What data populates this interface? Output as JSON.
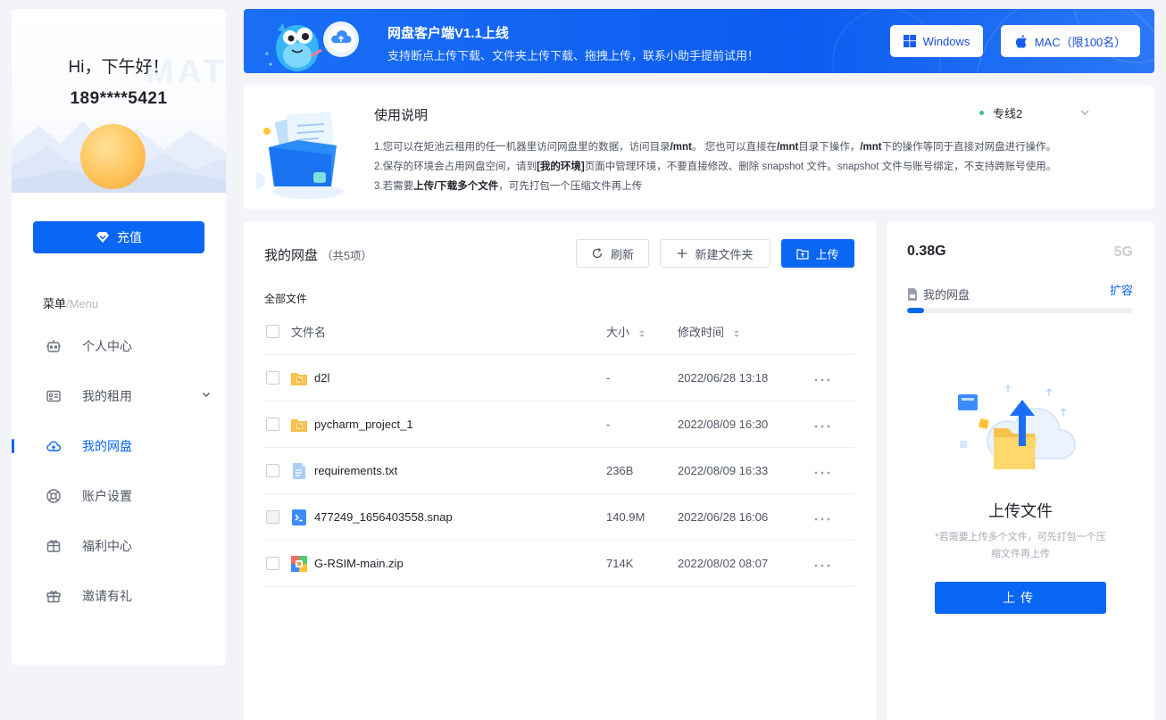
{
  "sidebar": {
    "hero_watermark": "MATPOOL",
    "greeting": "Hi，下午好！",
    "phone": "189****5421",
    "recharge_label": "充值",
    "menu_title": "菜单",
    "menu_title_en": "/Menu",
    "items": [
      {
        "label": "个人中心",
        "icon": "robot-icon"
      },
      {
        "label": "我的租用",
        "icon": "id-card-icon"
      },
      {
        "label": "我的网盘",
        "icon": "cloud-icon",
        "active": true
      },
      {
        "label": "账户设置",
        "icon": "lifebuoy-icon"
      },
      {
        "label": "福利中心",
        "icon": "gift-box-icon"
      },
      {
        "label": "邀请有礼",
        "icon": "present-icon"
      }
    ]
  },
  "banner": {
    "title": "网盘客户端V1.1上线",
    "subtitle": "支持断点上传下载、文件夹上传下载、拖拽上传，联系小助手提前试用！",
    "windows_label": "Windows",
    "mac_label": "MAC（限100名）"
  },
  "instructions": {
    "title": "使用说明",
    "line_selector": "专线2",
    "line1": {
      "t1": "1.您可以在矩池云租用的任一机器里访问网盘里的数据，访问目录",
      "b1": "/mnt",
      "t2": "。 您也可以直接在",
      "b2": "/mnt",
      "t3": "目录下操作，",
      "b3": "/mnt",
      "t4": "下的操作等同于直接对网盘进行操作。"
    },
    "line2": {
      "t1": "2.保存的环境会占用网盘空间，请到",
      "b1": "[我的环境]",
      "t2": "页面中管理环境，不要直接修改、删除 snapshot 文件。snapshot 文件与账号绑定，不支持跨账号使用。"
    },
    "line3": {
      "t1": "3.若需要",
      "b1": "上传/下载多个文件",
      "t2": "，可先打包一个压缩文件再上传"
    }
  },
  "files": {
    "title": "我的网盘",
    "count": "（共5项）",
    "refresh_label": "刷新",
    "new_folder_label": "新建文件夹",
    "upload_label": "上传",
    "breadcrumb": "全部文件",
    "columns": {
      "name": "文件名",
      "size": "大小",
      "modified": "修改时间"
    },
    "rows": [
      {
        "name": "d2l",
        "size": "-",
        "modified": "2022/06/28 13:18",
        "type": "folder"
      },
      {
        "name": "pycharm_project_1",
        "size": "-",
        "modified": "2022/08/09 16:30",
        "type": "folder"
      },
      {
        "name": "requirements.txt",
        "size": "236B",
        "modified": "2022/08/09 16:33",
        "type": "text"
      },
      {
        "name": "477249_1656403558.snap",
        "size": "140.9M",
        "modified": "2022/06/28 16:06",
        "type": "snap"
      },
      {
        "name": "G-RSIM-main.zip",
        "size": "714K",
        "modified": "2022/08/02 08:07",
        "type": "zip"
      }
    ],
    "more_symbol": "···"
  },
  "capacity": {
    "used": "0.38G",
    "total": "5G",
    "label": "我的网盘",
    "expand_label": "扩容",
    "usage_fraction": 0.076,
    "upload_title": "上传文件",
    "upload_hint": "*若需要上传多个文件，可先打包一个压缩文件再上传",
    "upload_button": "上传"
  },
  "colors": {
    "accent": "#0a66f5",
    "folder": "#f7c14d",
    "active_dot": "#38c08f"
  }
}
